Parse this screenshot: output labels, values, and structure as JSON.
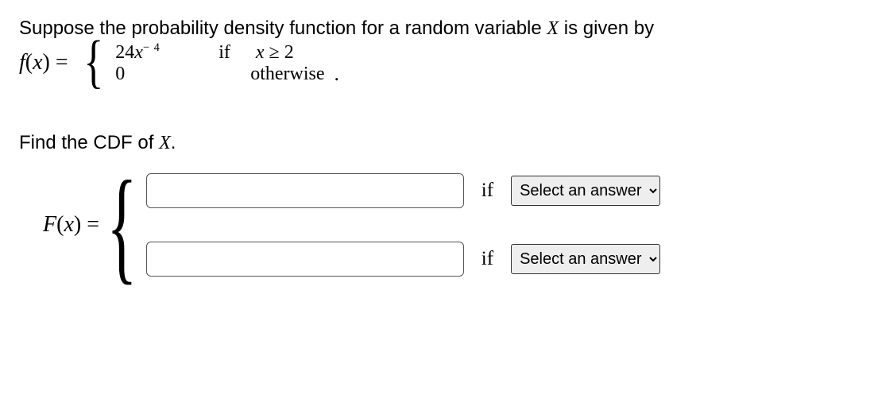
{
  "intro": {
    "line1_pre": "Suppose the probability density function for a random variable ",
    "line1_var": "X",
    "line1_post": " is given by"
  },
  "pdf": {
    "lhs_f": "f",
    "lhs_open": "(",
    "lhs_x": "x",
    "lhs_close": ") = ",
    "case1_expr_a": "24",
    "case1_expr_x": "x",
    "case1_exp": "− 4",
    "case1_if": "if",
    "case1_cond_x": "x",
    "case1_cond_rest": " ≥ 2",
    "case2_val": "0",
    "case2_cond": "otherwise",
    "period": "."
  },
  "prompt2": {
    "pre": "Find the CDF of ",
    "var": "X",
    "post": "."
  },
  "cdf": {
    "lhs_F": "F",
    "lhs_open": "(",
    "lhs_x": "x",
    "lhs_close": ") =",
    "row1_if": "if",
    "row2_if": "if",
    "select_placeholder": "Select an answer"
  }
}
